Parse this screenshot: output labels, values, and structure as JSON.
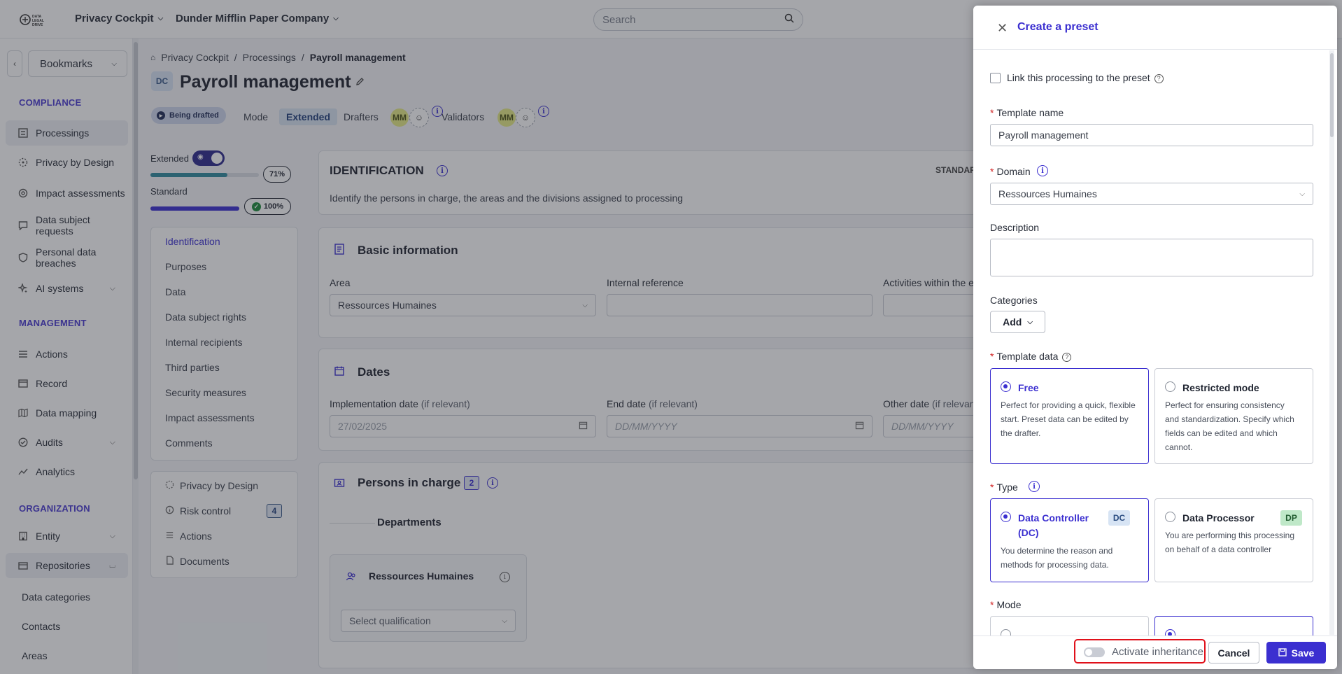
{
  "topbar": {
    "logo_text": "DATA LEGAL DRIVE",
    "product": "Privacy Cockpit",
    "company": "Dunder Mifflin Paper Company",
    "search_placeholder": "Search"
  },
  "sidebar": {
    "bookmarks": "Bookmarks",
    "compliance_title": "COMPLIANCE",
    "compliance_items": [
      {
        "label": "Processings",
        "icon": "processings-icon"
      },
      {
        "label": "Privacy by Design",
        "icon": "privacy-design-icon"
      },
      {
        "label": "Impact assessments",
        "icon": "impact-icon"
      },
      {
        "label": "Data subject requests",
        "icon": "chat-icon"
      },
      {
        "label": "Personal data breaches",
        "icon": "shield-icon"
      },
      {
        "label": "AI systems",
        "icon": "sparkle-icon"
      }
    ],
    "management_title": "MANAGEMENT",
    "management_items": [
      {
        "label": "Actions",
        "icon": "list-icon"
      },
      {
        "label": "Record",
        "icon": "record-icon"
      },
      {
        "label": "Data mapping",
        "icon": "map-icon"
      },
      {
        "label": "Audits",
        "icon": "check-circle-icon"
      },
      {
        "label": "Analytics",
        "icon": "analytics-icon"
      }
    ],
    "organization_title": "ORGANIZATION",
    "organization_items": [
      {
        "label": "Entity",
        "icon": "building-icon"
      },
      {
        "label": "Repositories",
        "icon": "folder-icon"
      }
    ],
    "repositories_sub": [
      "Data categories",
      "Contacts",
      "Areas"
    ]
  },
  "main": {
    "breadcrumb": [
      "Privacy Cockpit",
      "Processings",
      "Payroll management"
    ],
    "type_badge": "DC",
    "title": "Payroll management",
    "status": "Being drafted",
    "mode_label": "Mode",
    "mode_value": "Extended",
    "drafters_label": "Drafters",
    "validators_label": "Validators",
    "drafter_initials": "MM",
    "validator_initials": "MM",
    "extended_label": "Extended",
    "extended_pct": "71%",
    "extended_progress": 0.71,
    "standard_label": "Standard",
    "standard_pct": "100%",
    "standard_progress": 1.0,
    "tabs": [
      "Identification",
      "Purposes",
      "Data",
      "Data subject rights",
      "Internal recipients",
      "Third parties",
      "Security measures",
      "Impact assessments",
      "Comments"
    ],
    "tools": [
      {
        "label": "Privacy by Design",
        "icon": "privacy-design-icon"
      },
      {
        "label": "Risk control",
        "icon": "info-circle-icon",
        "count": "4"
      },
      {
        "label": "Actions",
        "icon": "list-icon"
      },
      {
        "label": "Documents",
        "icon": "document-icon"
      }
    ],
    "identification_title": "IDENTIFICATION",
    "identification_standard": "STANDAR",
    "identification_desc": "Identify the persons in charge, the areas and the divisions assigned to processing",
    "basic_info_title": "Basic information",
    "area_label": "Area",
    "area_value": "Ressources Humaines",
    "internal_ref_label": "Internal reference",
    "activities_label": "Activities within the e",
    "dates_title": "Dates",
    "impl_date_label": "Implementation date",
    "if_relevant": "(if relevant)",
    "impl_date_value": "27/02/2025",
    "end_date_label": "End date",
    "end_date_placeholder": "DD/MM/YYYY",
    "other_date_label": "Other date",
    "other_if_relevant": "(if relevan",
    "other_date_placeholder": "DD/MM/YYYY",
    "persons_title": "Persons in charge",
    "persons_count": "2",
    "departments_label": "Departments",
    "dept_name": "Ressources Humaines",
    "qualification_placeholder": "Select qualification"
  },
  "drawer": {
    "title": "Create a preset",
    "link_label": "Link this processing to the preset",
    "template_name_label": "Template name",
    "template_name_value": "Payroll management",
    "domain_label": "Domain",
    "domain_value": "Ressources Humaines",
    "description_label": "Description",
    "categories_label": "Categories",
    "add_button": "Add",
    "template_data_label": "Template data",
    "free_title": "Free",
    "free_desc_1": "Perfect for providing a quick, flexible",
    "free_desc_2": "start. Preset data can be edited by",
    "free_desc_3": "the drafter.",
    "restricted_title": "Restricted mode",
    "restricted_desc_1": "Perfect for ensuring consistency",
    "restricted_desc_2": "and standardization. Specify which",
    "restricted_desc_3": "fields can be edited and which",
    "restricted_desc_4": "cannot.",
    "type_label": "Type",
    "dc_title_1": "Data Controller",
    "dc_title_2": "(DC)",
    "dc_tag": "DC",
    "dc_desc_1": "You determine the reason and",
    "dc_desc_2": "methods for processing data.",
    "dp_title": "Data Processor",
    "dp_tag": "DP",
    "dp_desc_1": "You are performing this processing",
    "dp_desc_2": "on behalf of a data controller",
    "mode_label": "Mode",
    "activate_inheritance": "Activate inheritance",
    "cancel": "Cancel",
    "save": "Save"
  },
  "colors": {
    "accent": "#3b2fd0",
    "highlight": "#e0101a",
    "dc_tag_bg": "#d7e4f4",
    "dp_tag_bg": "#bfe8c8"
  }
}
